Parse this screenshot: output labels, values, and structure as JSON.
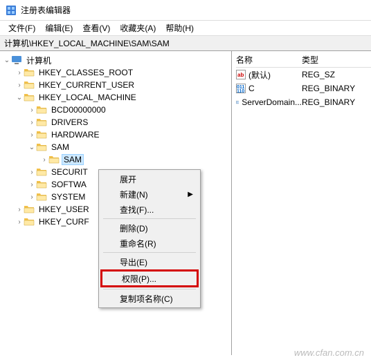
{
  "title": "注册表编辑器",
  "menu": {
    "file": "文件(F)",
    "edit": "编辑(E)",
    "view": "查看(V)",
    "favorites": "收藏夹(A)",
    "help": "帮助(H)"
  },
  "address": "计算机\\HKEY_LOCAL_MACHINE\\SAM\\SAM",
  "tree": {
    "root": "计算机",
    "hkcr": "HKEY_CLASSES_ROOT",
    "hkcu": "HKEY_CURRENT_USER",
    "hklm": "HKEY_LOCAL_MACHINE",
    "bcd": "BCD00000000",
    "drivers": "DRIVERS",
    "hardware": "HARDWARE",
    "sam": "SAM",
    "sam2": "SAM",
    "security": "SECURIT",
    "software": "SOFTWA",
    "system": "SYSTEM",
    "hku": "HKEY_USER",
    "hkcc": "HKEY_CURF"
  },
  "list": {
    "col_name": "名称",
    "col_type": "类型",
    "rows": [
      {
        "name": "(默认)",
        "type": "REG_SZ",
        "icon": "sz"
      },
      {
        "name": "C",
        "type": "REG_BINARY",
        "icon": "bin"
      },
      {
        "name": "ServerDomain...",
        "type": "REG_BINARY",
        "icon": "bin"
      }
    ]
  },
  "ctx": {
    "expand": "展开",
    "new": "新建(N)",
    "find": "查找(F)...",
    "delete": "删除(D)",
    "rename": "重命名(R)",
    "export": "导出(E)",
    "permissions": "权限(P)...",
    "copykey": "复制项名称(C)"
  },
  "watermark": "www.cfan.com.cn"
}
